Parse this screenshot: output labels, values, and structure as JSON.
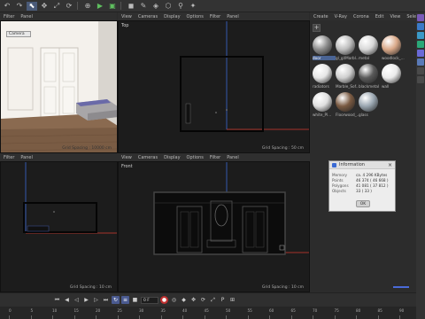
{
  "toolbar": {
    "icons": [
      "undo-icon",
      "redo-icon",
      "select-icon",
      "move-icon",
      "scale-icon",
      "rotate-icon",
      "axis-icon",
      "render-icon",
      "render-view-icon",
      "cube-icon",
      "pen-icon",
      "deformer-icon",
      "scene-icon",
      "camera-icon",
      "light-icon"
    ]
  },
  "viewports": {
    "perspective": {
      "menu": [
        "Filter",
        "Panel"
      ],
      "camera_label": "Camera",
      "grid_spacing": "Grid Spacing : 10000 cm"
    },
    "top": {
      "menu": [
        "View",
        "Cameras",
        "Display",
        "Options",
        "Filter",
        "Panel"
      ],
      "label": "Top",
      "grid_spacing": "Grid Spacing : 50 cm"
    },
    "right": {
      "menu": [
        "Filter",
        "Panel"
      ],
      "grid_spacing": "Grid Spacing : 10 cm"
    },
    "front": {
      "menu": [
        "View",
        "Cameras",
        "Display",
        "Options",
        "Filter",
        "Panel"
      ],
      "label": "Front",
      "grid_spacing": "Grid Spacing : 10 cm"
    }
  },
  "material_manager": {
    "menu": [
      "Create",
      "V-Ray",
      "Corona",
      "Edit",
      "View",
      "Select"
    ],
    "materials": [
      {
        "name": "door",
        "color": "#8c8c8c",
        "selected": true
      },
      {
        "name": "gl_gl/Marbl...",
        "color": "#bdbdbd"
      },
      {
        "name": "metal",
        "color": "#d8d8d8"
      },
      {
        "name": "woodlock_...",
        "color": "#d9a888"
      },
      {
        "name": "radiators",
        "color": "#e6e6e6"
      },
      {
        "name": "Marble_Sof...",
        "color": "#cfcfcf"
      },
      {
        "name": "blackmetal",
        "color": "#5a5a5a"
      },
      {
        "name": "wall",
        "color": "#ebebeb"
      },
      {
        "name": "white_Pl...",
        "color": "#e0e0e0"
      },
      {
        "name": "Floorwood_...",
        "color": "#7a5a42"
      },
      {
        "name": "glass",
        "color": "#9aa6b0"
      }
    ]
  },
  "info_dialog": {
    "title": "Information",
    "rows": [
      {
        "key": "Memory",
        "value": "ca. 4 296 KBytes"
      },
      {
        "key": "Points",
        "value": "46 374 ( 46 668 )"
      },
      {
        "key": "Polygons",
        "value": "41 081 ( 37 812 )"
      },
      {
        "key": "Objects",
        "value": "33 ( 33 )"
      }
    ],
    "ok_label": "OK"
  },
  "timeline": {
    "current_frame": "0 F",
    "ruler_ticks": [
      "0",
      "5",
      "10",
      "15",
      "20",
      "25",
      "30",
      "35",
      "40",
      "45",
      "50",
      "55",
      "60",
      "65",
      "70",
      "75",
      "80",
      "85",
      "90"
    ]
  },
  "colors": {
    "axis_red": "#d43a2f",
    "axis_blue": "#3a6ad4",
    "accent": "#4a6494"
  }
}
